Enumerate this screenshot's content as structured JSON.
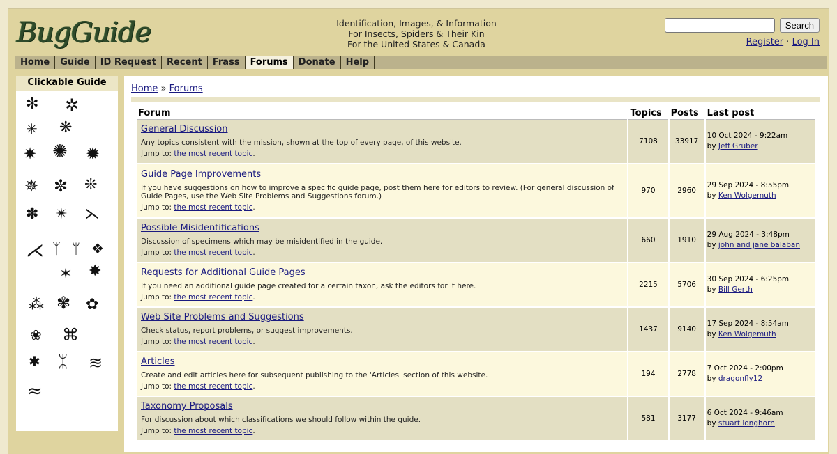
{
  "header": {
    "logo": "BugGuide",
    "tagline": [
      "Identification, Images, & Information",
      "For Insects, Spiders & Their Kin",
      "For the United States & Canada"
    ],
    "search": {
      "value": "",
      "placeholder": "",
      "button_label": "Search"
    },
    "register_label": "Register",
    "separator": "·",
    "login_label": "Log In"
  },
  "nav": {
    "items": [
      {
        "label": "Home"
      },
      {
        "label": "Guide"
      },
      {
        "label": "ID Request"
      },
      {
        "label": "Recent"
      },
      {
        "label": "Frass"
      },
      {
        "label": "Forums",
        "active": true
      },
      {
        "label": "Donate"
      },
      {
        "label": "Help"
      }
    ]
  },
  "sidebar": {
    "title": "Clickable Guide",
    "icons": [
      "moth-icon",
      "butterfly-icon",
      "fly-icon",
      "caterpillar-icon",
      "crane-fly-icon",
      "dragonfly-icon",
      "mosquito-icon",
      "grasshopper-mantis-icon",
      "cockroach-icon",
      "fly-icon-2",
      "bee-icon",
      "wasp-icon",
      "walkingstick-icon",
      "earwig-icon",
      "ant-icon",
      "termite-icon",
      "cicada-icon",
      "assassin-bug-icon",
      "true-bug-icon",
      "beetle-icon",
      "longhorn-beetle-icon",
      "flea-icon",
      "cricket-icon",
      "tick-icon",
      "spider-icon",
      "scorpion-icon",
      "centipede-icon",
      "millipede-icon"
    ]
  },
  "breadcrumb": {
    "home": "Home",
    "separator": "»",
    "current": "Forums"
  },
  "table": {
    "headers": {
      "forum": "Forum",
      "topics": "Topics",
      "posts": "Posts",
      "last_post": "Last post"
    },
    "jump_label": "Jump to:",
    "jump_link": "the most recent topic",
    "by_label": "by",
    "rows": [
      {
        "title": "General Discussion",
        "desc": "Any topics consistent with the mission, shown at the top of every page, of this website.",
        "topics": "7108",
        "posts": "33917",
        "last_date": "10 Oct 2024 - 9:22am",
        "last_user": "Jeff Gruber"
      },
      {
        "title": "Guide Page Improvements",
        "desc": "If you have suggestions on how to improve a specific guide page, post them here for editors to review. (For general discussion of Guide Pages, use the Web Site Problems and Suggestions forum.)",
        "topics": "970",
        "posts": "2960",
        "last_date": "29 Sep 2024 - 8:55pm",
        "last_user": "Ken Wolgemuth"
      },
      {
        "title": "Possible Misidentifications",
        "desc": "Discussion of specimens which may be misidentified in the guide.",
        "topics": "660",
        "posts": "1910",
        "last_date": "29 Aug 2024 - 3:48pm",
        "last_user": "john and jane balaban"
      },
      {
        "title": "Requests for Additional Guide Pages",
        "desc": "If you need an additional guide page created for a certain taxon, ask the editors for it here.",
        "topics": "2215",
        "posts": "5706",
        "last_date": "30 Sep 2024 - 6:25pm",
        "last_user": "Bill Gerth"
      },
      {
        "title": "Web Site Problems and Suggestions",
        "desc": "Check status, report problems, or suggest improvements.",
        "topics": "1437",
        "posts": "9140",
        "last_date": "17 Sep 2024 - 8:54am",
        "last_user": "Ken Wolgemuth"
      },
      {
        "title": "Articles",
        "desc": "Create and edit articles here for subsequent publishing to the 'Articles' section of this website.",
        "topics": "194",
        "posts": "2778",
        "last_date": "7 Oct 2024 - 2:00pm",
        "last_user": "dragonfly12"
      },
      {
        "title": "Taxonomy Proposals",
        "desc": "For discussion about which classifications we should follow within the guide.",
        "topics": "581",
        "posts": "3177",
        "last_date": "6 Oct 2024 - 9:46am",
        "last_user": "stuart longhorn"
      }
    ]
  },
  "colors": {
    "page_bg": "#efe9cf",
    "frame_bg": "#dfd49f",
    "nav_bg": "#bbb28c",
    "row_dark": "#e3dfc3",
    "row_light": "#fcf8dd",
    "link": "#1a1a80"
  }
}
